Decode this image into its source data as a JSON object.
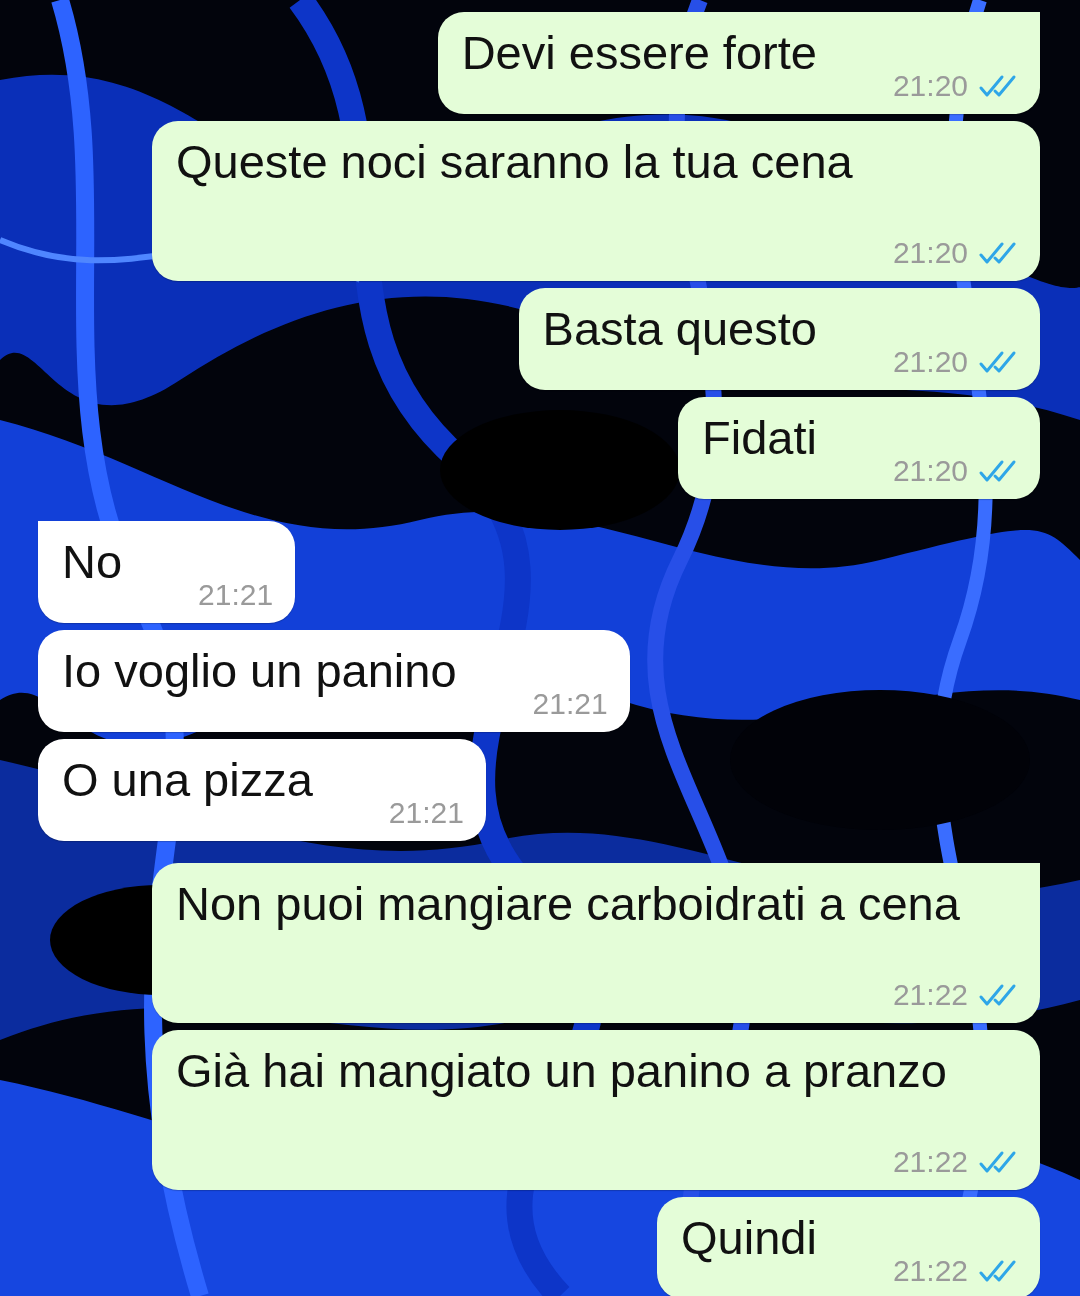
{
  "messages": [
    {
      "kind": "sent",
      "tail": true,
      "text": "Devi essere forte",
      "time": "21:20",
      "read": true
    },
    {
      "kind": "sent",
      "tail": false,
      "text": "Queste noci saranno la tua cena",
      "time": "21:20",
      "read": true
    },
    {
      "kind": "sent",
      "tail": false,
      "text": "Basta questo",
      "time": "21:20",
      "read": true
    },
    {
      "kind": "sent",
      "tail": false,
      "text": "Fidati",
      "time": "21:20",
      "read": true
    },
    {
      "kind": "received",
      "tail": true,
      "text": "No",
      "time": "21:21"
    },
    {
      "kind": "received",
      "tail": false,
      "text": "Io voglio un panino",
      "time": "21:21"
    },
    {
      "kind": "received",
      "tail": false,
      "text": "O una pizza",
      "time": "21:21"
    },
    {
      "kind": "sent",
      "tail": true,
      "text": "Non puoi mangiare carboidrati a cena",
      "time": "21:22",
      "read": true
    },
    {
      "kind": "sent",
      "tail": false,
      "text": "Già hai mangiato un panino a pranzo",
      "time": "21:22",
      "read": true
    },
    {
      "kind": "sent",
      "tail": false,
      "text": "Quindi",
      "time": "21:22",
      "read": true
    }
  ]
}
